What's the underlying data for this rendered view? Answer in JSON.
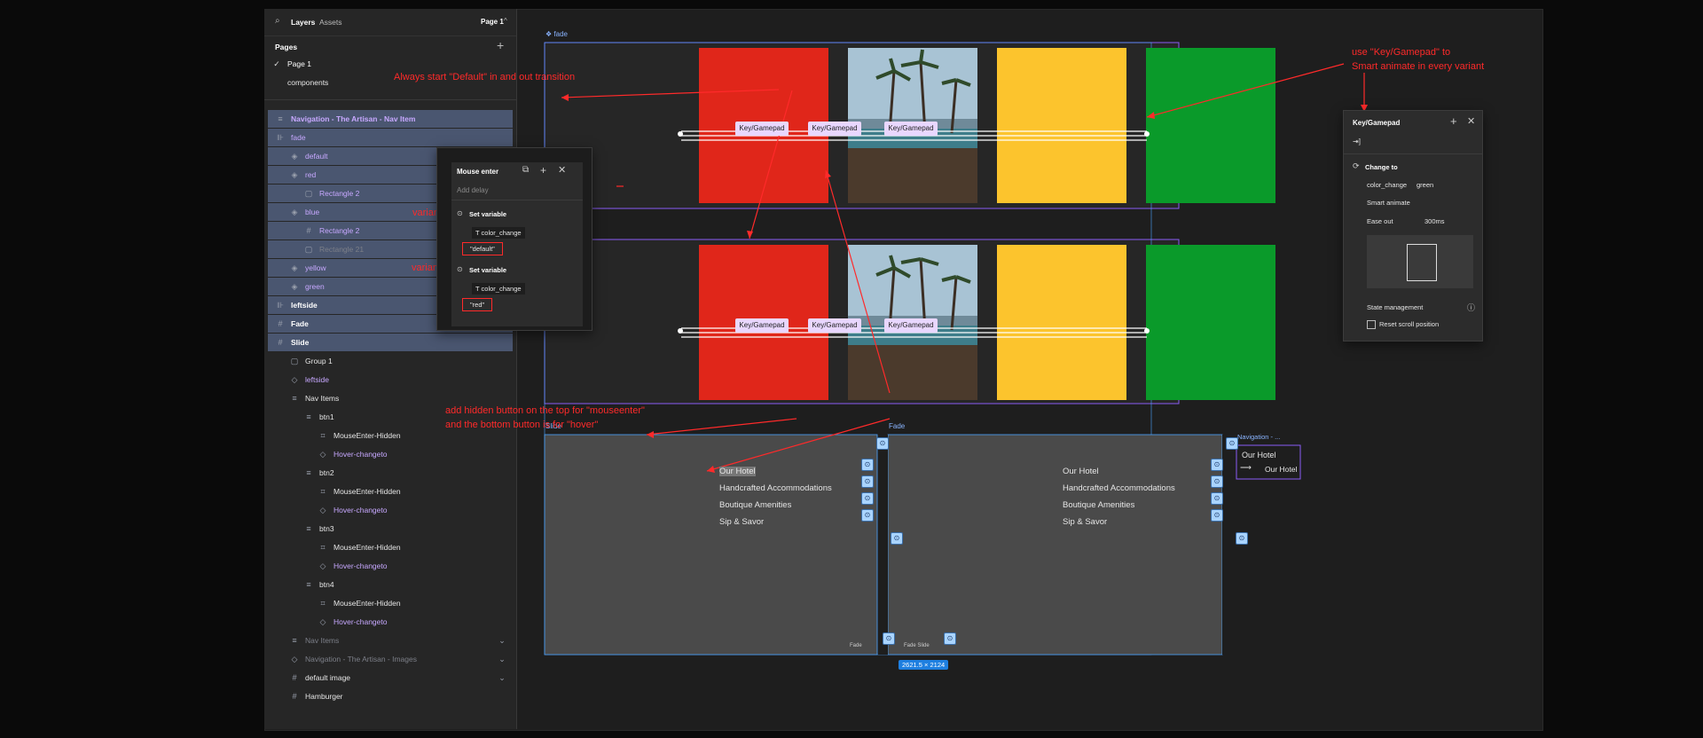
{
  "layers_panel": {
    "tab_layers": "Layers",
    "tab_assets": "Assets",
    "page_selector": "Page 1",
    "pages_heading": "Pages",
    "pages": [
      "Page 1",
      "components"
    ],
    "items": [
      {
        "label": "Navigation - The Artisan - Nav Item",
        "icon": "≡"
      },
      {
        "label": "fade",
        "icon": "⊪"
      },
      {
        "label": "default",
        "icon": "◈"
      },
      {
        "label": "red",
        "icon": "◈"
      },
      {
        "label": "Rectangle 2",
        "icon": "▢"
      },
      {
        "label": "blue",
        "icon": "◈"
      },
      {
        "label": "Rectangle 2",
        "icon": "#"
      },
      {
        "label": "Rectangle 21",
        "icon": "▢"
      },
      {
        "label": "yellow",
        "icon": "◈"
      },
      {
        "label": "green",
        "icon": "◈"
      },
      {
        "label": "leftside",
        "icon": "⊪"
      },
      {
        "label": "Fade",
        "icon": "#"
      },
      {
        "label": "Slide",
        "icon": "#"
      },
      {
        "label": "Group 1",
        "icon": "▢"
      },
      {
        "label": "leftside",
        "icon": "◇"
      },
      {
        "label": "Nav Items",
        "icon": "≡"
      },
      {
        "label": "btn1",
        "icon": "≡"
      },
      {
        "label": "MouseEnter-Hidden",
        "icon": "⌗"
      },
      {
        "label": "Hover-changeto",
        "icon": "◇"
      },
      {
        "label": "btn2",
        "icon": "≡"
      },
      {
        "label": "MouseEnter-Hidden",
        "icon": "⌗"
      },
      {
        "label": "Hover-changeto",
        "icon": "◇"
      },
      {
        "label": "btn3",
        "icon": "≡"
      },
      {
        "label": "MouseEnter-Hidden",
        "icon": "⌗"
      },
      {
        "label": "Hover-changeto",
        "icon": "◇"
      },
      {
        "label": "btn4",
        "icon": "≡"
      },
      {
        "label": "MouseEnter-Hidden",
        "icon": "⌗"
      },
      {
        "label": "Hover-changeto",
        "icon": "◇"
      },
      {
        "label": "Nav Items",
        "icon": "≡"
      },
      {
        "label": "Navigation - The Artisan - Images",
        "icon": "◇"
      },
      {
        "label": "default image",
        "icon": "#"
      },
      {
        "label": "Hamburger",
        "icon": "#"
      }
    ]
  },
  "canvas": {
    "fade_label": "fade",
    "chip_label": "Key/Gamepad",
    "slide_label": "Slide",
    "fade_frame_label": "Fade",
    "nav_label": "Navigation - ...",
    "size_badge": "2621.5 × 2124",
    "nav_items": [
      "Our Hotel",
      "Handcrafted Accommodations",
      "Boutique Amenities",
      "Sip & Savor"
    ],
    "nav_preview": [
      "Our Hotel",
      "Our Hotel"
    ],
    "small_labels": [
      "Fade",
      "Fade Slide"
    ]
  },
  "mouse_panel": {
    "trigger": "Mouse enter",
    "add_delay": "Add delay",
    "action1": "Set variable",
    "var1": "color_change",
    "value1": "\"default\"",
    "action2": "Set variable",
    "var2": "color_change",
    "value2": "\"red\""
  },
  "key_panel": {
    "trigger": "Key/Gamepad",
    "key_icon": "⇥]",
    "action": "Change to",
    "prop_name": "color_change",
    "prop_value": "green",
    "animation": "Smart animate",
    "easing": "Ease out",
    "duration": "300ms",
    "state_label": "State management",
    "reset_label": "Reset scroll position"
  },
  "annotations": {
    "always_start": "Always start \"Default\" in and out transition",
    "use_key": "use \"Key/Gamepad\" to",
    "use_key2": "Smart animate in every variant",
    "variant1": "variant1",
    "variant2": "variant2",
    "hidden_button": "add hidden button on the top for \"mouseenter\"",
    "hidden_button2": "and the bottom button is for \"hover\""
  },
  "colors": {
    "red_card": "#e0261a",
    "yellow_card": "#fcc42d",
    "green_card": "#0a9a2a",
    "annotation": "#ff2a2a",
    "selection": "#8a5cf5"
  }
}
